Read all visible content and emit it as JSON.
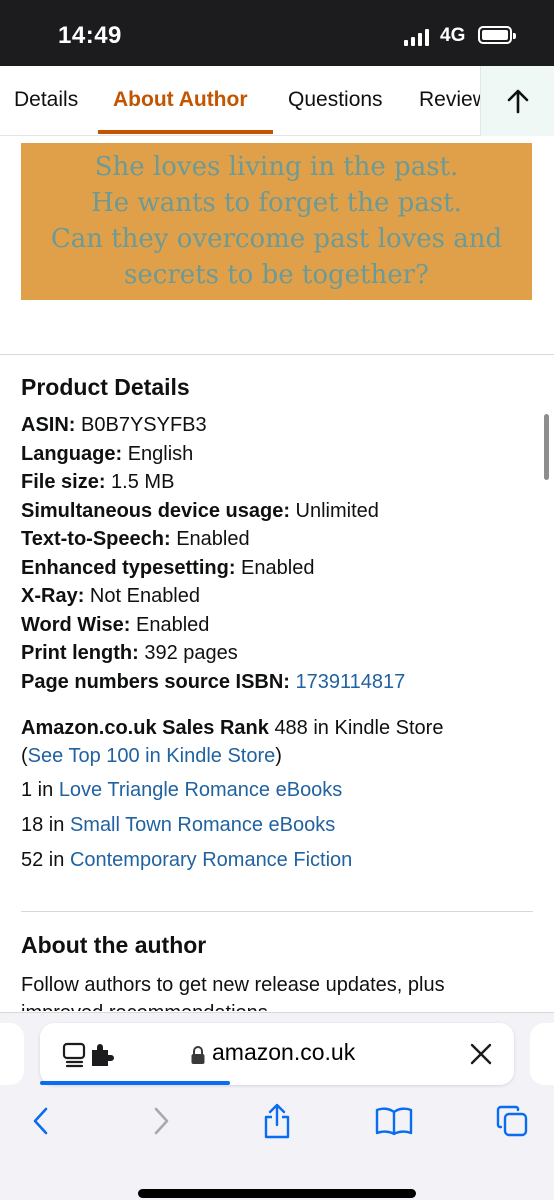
{
  "status_bar": {
    "time": "14:49",
    "network": "4G"
  },
  "tabs": [
    {
      "label": "Details"
    },
    {
      "label": "About Author"
    },
    {
      "label": "Questions"
    },
    {
      "label": "Reviews"
    }
  ],
  "banner": {
    "lines": [
      "She loves living in the past.",
      "He wants to forget the past.",
      "Can they overcome past loves and",
      "secrets to be together?"
    ]
  },
  "product_details": {
    "title": "Product Details",
    "rows": [
      {
        "label": "ASIN:",
        "value": "B0B7YSYFB3"
      },
      {
        "label": "Language:",
        "value": "English"
      },
      {
        "label": "File size:",
        "value": "1.5 MB"
      },
      {
        "label": "Simultaneous device usage:",
        "value": "Unlimited"
      },
      {
        "label": "Text-to-Speech:",
        "value": "Enabled"
      },
      {
        "label": "Enhanced typesetting:",
        "value": "Enabled"
      },
      {
        "label": "X-Ray:",
        "value": "Not Enabled"
      },
      {
        "label": "Word Wise:",
        "value": "Enabled"
      },
      {
        "label": "Print length:",
        "value": "392 pages"
      },
      {
        "label": "Page numbers source ISBN:",
        "value": "1739114817"
      }
    ]
  },
  "sales_rank": {
    "label": "Amazon.co.uk Sales Rank",
    "value": "488 in Kindle Store",
    "see_top_open": "(",
    "see_top_link": "See Top 100 in Kindle Store",
    "see_top_close": ")",
    "categories": [
      {
        "rank": "1 in",
        "name": "Love Triangle Romance eBooks"
      },
      {
        "rank": "18 in",
        "name": "Small Town Romance eBooks"
      },
      {
        "rank": "52 in",
        "name": "Contemporary Romance Fiction"
      }
    ]
  },
  "about_author": {
    "title": "About the author",
    "text": "Follow authors to get new release updates, plus",
    "text_cut": "improved recommendations."
  },
  "browser": {
    "url": "amazon.co.uk"
  },
  "colors": {
    "accent": "#c45500",
    "link": "#2162a1",
    "banner_bg": "#e0a04a",
    "banner_text": "#6c9a96",
    "ios_blue": "#0a6cf0"
  }
}
